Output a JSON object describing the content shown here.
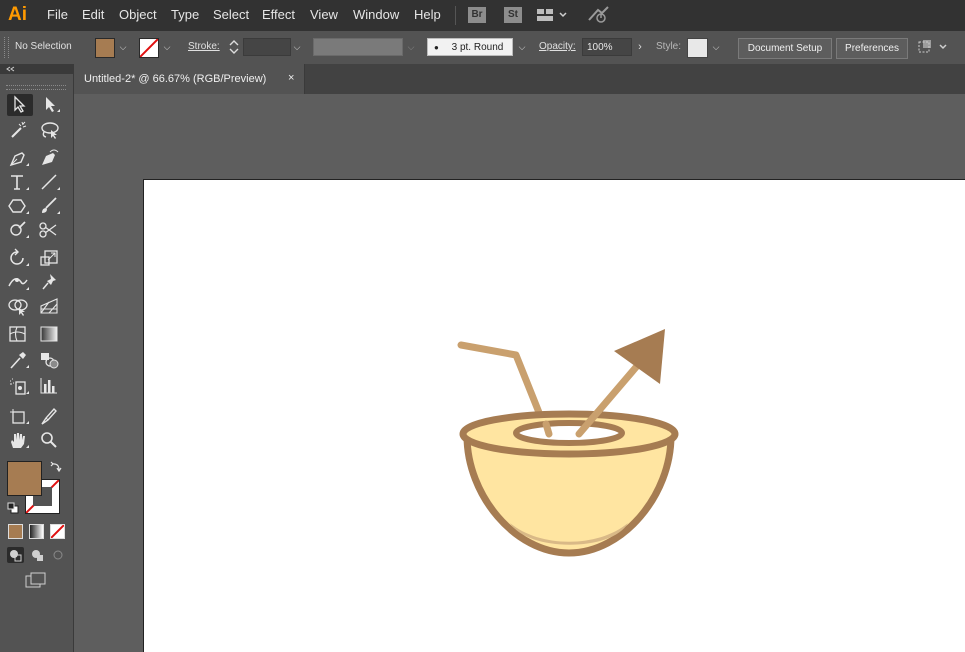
{
  "app": {
    "name": "Ai"
  },
  "menu": [
    "File",
    "Edit",
    "Object",
    "Type",
    "Select",
    "Effect",
    "View",
    "Window",
    "Help"
  ],
  "menu_icons": {
    "bridge": "Br",
    "stock": "St"
  },
  "control": {
    "selection": "No Selection",
    "stroke_label": "Stroke:",
    "brush": "3 pt. Round",
    "opacity_label": "Opacity:",
    "opacity_value": "100%",
    "style_label": "Style:",
    "document_setup": "Document Setup",
    "preferences": "Preferences"
  },
  "colors": {
    "fill": "#a67c52",
    "stroke": "none",
    "accent": "#ff9a00",
    "coconut_fill": "#ffe5a1",
    "coconut_outline": "#a67c52"
  },
  "document": {
    "tab_title": "Untitled-2* @ 66.67% (RGB/Preview)",
    "close_glyph": "×"
  },
  "tools": [
    [
      "selection-tool-icon",
      "direct-selection-tool-icon"
    ],
    [
      "magic-wand-tool-icon",
      "lasso-tool-icon"
    ],
    [
      "pen-tool-icon",
      "curvature-tool-icon"
    ],
    [
      "type-tool-icon",
      "line-segment-tool-icon"
    ],
    [
      "shape-tool-icon",
      "paintbrush-tool-icon"
    ],
    [
      "shaper-tool-icon",
      "scissors-tool-icon"
    ],
    [
      "rotate-tool-icon",
      "scale-tool-icon"
    ],
    [
      "width-tool-icon",
      "puppet-warp-tool-icon"
    ],
    [
      "shape-builder-tool-icon",
      "perspective-grid-tool-icon"
    ],
    [
      "mesh-tool-icon",
      "gradient-tool-icon"
    ],
    [
      "eyedropper-tool-icon",
      "blend-tool-icon"
    ],
    [
      "symbol-sprayer-tool-icon",
      "column-graph-tool-icon"
    ],
    [
      "artboard-tool-icon",
      "slice-tool-icon"
    ],
    [
      "hand-tool-icon",
      "zoom-tool-icon"
    ]
  ]
}
